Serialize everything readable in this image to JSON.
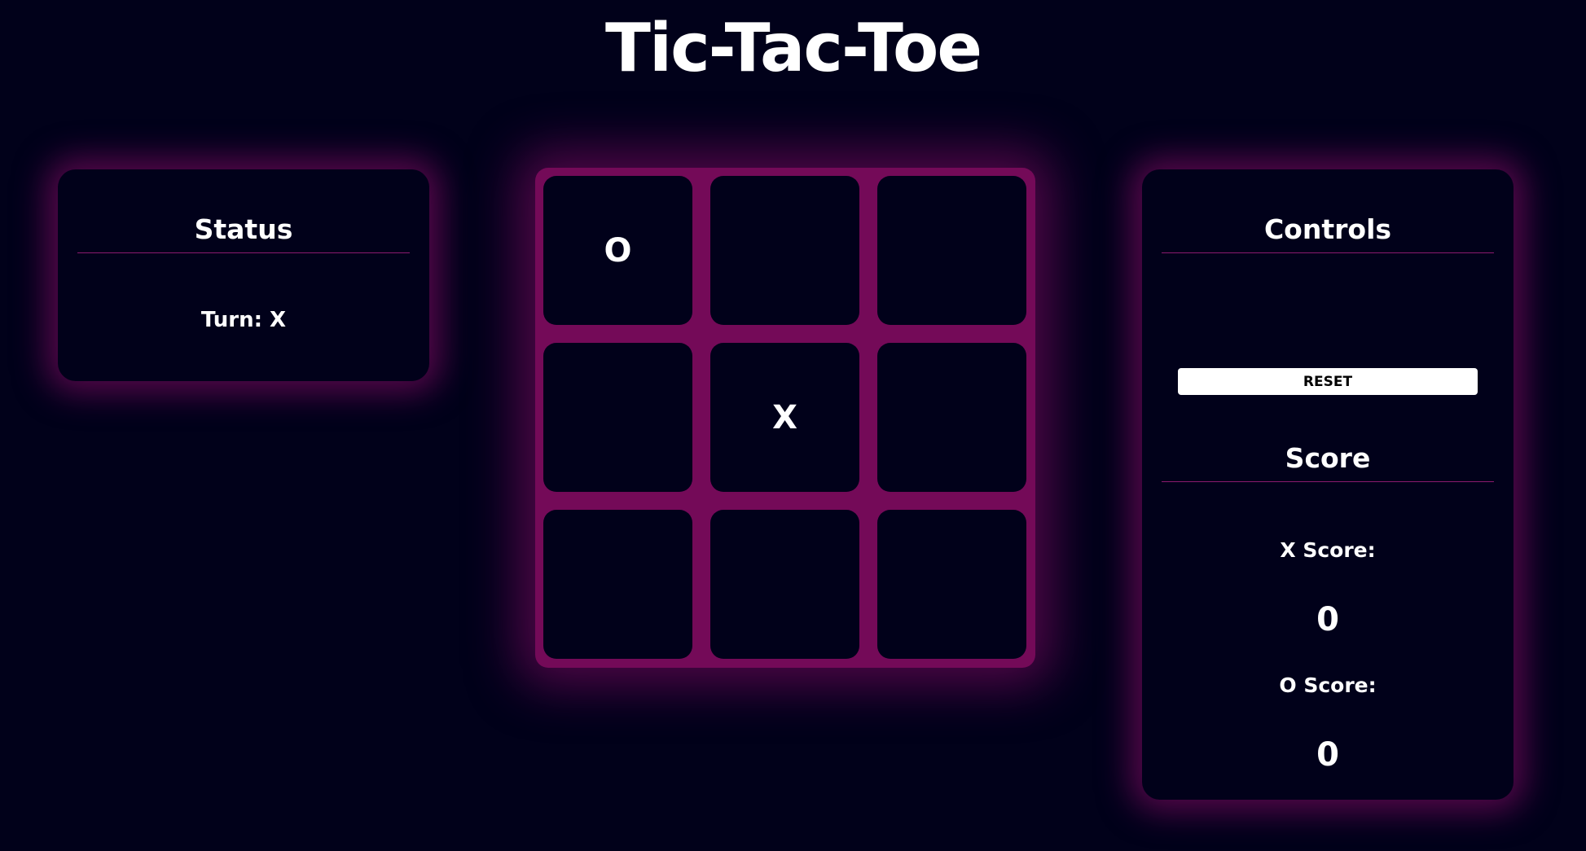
{
  "title": "Tic-Tac-Toe",
  "status": {
    "heading": "Status",
    "turn_text": "Turn: X"
  },
  "board": {
    "cells": [
      "O",
      "",
      "",
      "",
      "X",
      "",
      "",
      "",
      ""
    ]
  },
  "controls": {
    "heading": "Controls",
    "reset_label": "RESET"
  },
  "score": {
    "heading": "Score",
    "x_label": "X Score:",
    "x_value": "0",
    "o_label": "O Score:",
    "o_value": "0"
  },
  "colors": {
    "background": "#01011a",
    "glow": "#740a58",
    "text": "#ffffff"
  }
}
